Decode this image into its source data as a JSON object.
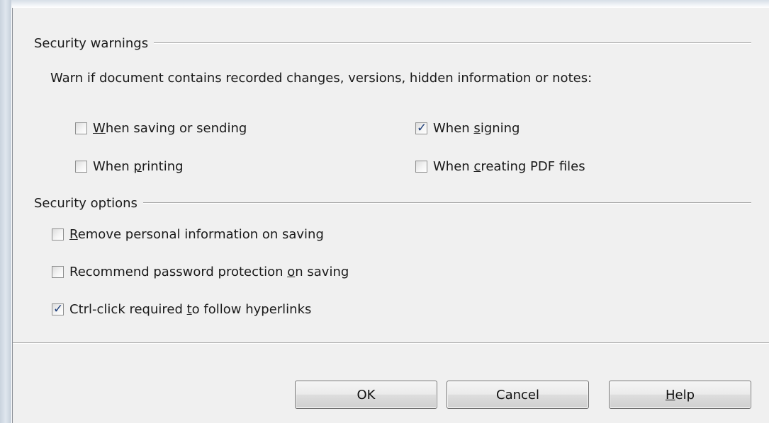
{
  "security_warnings": {
    "title": "Security warnings",
    "description": "Warn if document contains recorded changes, versions, hidden information or notes:",
    "options": [
      {
        "pre": "",
        "mnemonic": "W",
        "post": "hen saving or sending",
        "checked": false
      },
      {
        "pre": "When ",
        "mnemonic": "s",
        "post": "igning",
        "checked": true
      },
      {
        "pre": "When ",
        "mnemonic": "p",
        "post": "rinting",
        "checked": false
      },
      {
        "pre": "When ",
        "mnemonic": "c",
        "post": "reating PDF files",
        "checked": false
      }
    ]
  },
  "security_options": {
    "title": "Security options",
    "options": [
      {
        "pre": "",
        "mnemonic": "R",
        "post": "emove personal information on saving",
        "checked": false
      },
      {
        "pre": "Recommend password protection ",
        "mnemonic": "o",
        "post": "n saving",
        "checked": false
      },
      {
        "pre": "Ctrl-click required ",
        "mnemonic": "t",
        "post": "o follow hyperlinks",
        "checked": true
      }
    ]
  },
  "buttons": {
    "ok": {
      "label": "OK"
    },
    "cancel": {
      "label": "Cancel"
    },
    "help": {
      "pre": "",
      "mnemonic": "H",
      "post": "elp"
    }
  },
  "checkmark_glyph": "✓",
  "colors": {
    "dialog_bg": "#f0f0f0",
    "checkmark": "#1f3f7a",
    "frame": "#c9d3de"
  }
}
